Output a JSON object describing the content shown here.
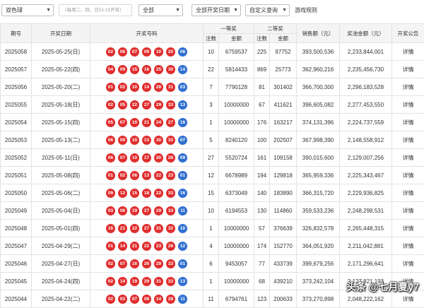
{
  "filters": {
    "game": "双色球",
    "schedule_hint": "（每周二、四、日21:15开奖）",
    "range": "全部",
    "date_type": "全部开奖日期",
    "custom_query": "自定义查询",
    "rules_link": "游戏规则"
  },
  "table": {
    "headers": {
      "issue": "期号",
      "date": "开奖日期",
      "numbers": "开奖号码",
      "first_prize": "一等奖",
      "second_prize": "二等奖",
      "count": "注数",
      "amount": "金额",
      "sales": "销售额（元）",
      "pool": "奖池金额（元）",
      "notice": "开奖公告"
    },
    "rows": [
      {
        "issue": "2025058",
        "date": "2025-05-25(日)",
        "reds": [
          "02",
          "06",
          "07",
          "09",
          "10",
          "20"
        ],
        "blue": "06",
        "first_count": "10",
        "first_amount": "6759537",
        "second_count": "225",
        "second_amount": "97752",
        "sales": "393,500,536",
        "pool": "2,233,844,001",
        "notice": "详情"
      },
      {
        "issue": "2025057",
        "date": "2025-05-22(四)",
        "reds": [
          "04",
          "09",
          "15",
          "16",
          "25",
          "30"
        ],
        "blue": "14",
        "first_count": "22",
        "first_amount": "5814433",
        "second_count": "869",
        "second_amount": "25773",
        "sales": "362,960,216",
        "pool": "2,235,456,730",
        "notice": "详情"
      },
      {
        "issue": "2025056",
        "date": "2025-05-20(二)",
        "reds": [
          "01",
          "02",
          "10",
          "14",
          "28",
          "31"
        ],
        "blue": "03",
        "first_count": "7",
        "first_amount": "7790128",
        "second_count": "81",
        "second_amount": "301402",
        "sales": "366,700,300",
        "pool": "2,296,183,528",
        "notice": "详情"
      },
      {
        "issue": "2025055",
        "date": "2025-05-18(日)",
        "reds": [
          "02",
          "05",
          "22",
          "27",
          "29",
          "33"
        ],
        "blue": "13",
        "first_count": "3",
        "first_amount": "10000000",
        "second_count": "67",
        "second_amount": "411621",
        "sales": "396,605,082",
        "pool": "2,277,453,550",
        "notice": "详情"
      },
      {
        "issue": "2025054",
        "date": "2025-05-15(四)",
        "reds": [
          "05",
          "07",
          "10",
          "21",
          "24",
          "27"
        ],
        "blue": "16",
        "first_count": "1",
        "first_amount": "10000000",
        "second_count": "176",
        "second_amount": "163217",
        "sales": "374,131,396",
        "pool": "2,224,737,559",
        "notice": "详情"
      },
      {
        "issue": "2025053",
        "date": "2025-05-13(二)",
        "reds": [
          "06",
          "09",
          "10",
          "13",
          "30",
          "33"
        ],
        "blue": "07",
        "first_count": "5",
        "first_amount": "8240120",
        "second_count": "100",
        "second_amount": "202507",
        "sales": "367,998,390",
        "pool": "2,148,558,912",
        "notice": "详情"
      },
      {
        "issue": "2025052",
        "date": "2025-05-11(日)",
        "reds": [
          "06",
          "07",
          "10",
          "17",
          "20",
          "26"
        ],
        "blue": "09",
        "first_count": "27",
        "first_amount": "5520724",
        "second_count": "161",
        "second_amount": "109158",
        "sales": "390,015,600",
        "pool": "2,129,007,256",
        "notice": "详情"
      },
      {
        "issue": "2025051",
        "date": "2025-05-08(四)",
        "reds": [
          "01",
          "02",
          "06",
          "13",
          "22",
          "23"
        ],
        "blue": "01",
        "first_count": "12",
        "first_amount": "6678989",
        "second_count": "194",
        "second_amount": "129818",
        "sales": "365,959,336",
        "pool": "2,225,343,467",
        "notice": "详情"
      },
      {
        "issue": "2025050",
        "date": "2025-05-06(二)",
        "reds": [
          "09",
          "12",
          "15",
          "18",
          "22",
          "33"
        ],
        "blue": "16",
        "first_count": "15",
        "first_amount": "6373049",
        "second_count": "140",
        "second_amount": "183890",
        "sales": "366,315,720",
        "pool": "2,229,936,825",
        "notice": "详情"
      },
      {
        "issue": "2025049",
        "date": "2025-05-04(日)",
        "reds": [
          "03",
          "06",
          "19",
          "27",
          "29",
          "33"
        ],
        "blue": "11",
        "first_count": "10",
        "first_amount": "6194553",
        "second_count": "130",
        "second_amount": "114860",
        "sales": "359,533,236",
        "pool": "2,248,298,531",
        "notice": "详情"
      },
      {
        "issue": "2025048",
        "date": "2025-05-01(四)",
        "reds": [
          "16",
          "21",
          "22",
          "27",
          "31",
          "32"
        ],
        "blue": "10",
        "first_count": "1",
        "first_amount": "10000000",
        "second_count": "57",
        "second_amount": "376639",
        "sales": "326,832,578",
        "pool": "2,265,448,315",
        "notice": "详情"
      },
      {
        "issue": "2025047",
        "date": "2025-04-29(二)",
        "reds": [
          "01",
          "14",
          "21",
          "22",
          "23",
          "26"
        ],
        "blue": "12",
        "first_count": "4",
        "first_amount": "10000000",
        "second_count": "174",
        "second_amount": "152770",
        "sales": "364,051,920",
        "pool": "2,211,042,881",
        "notice": "详情"
      },
      {
        "issue": "2025046",
        "date": "2025-04-27(日)",
        "reds": [
          "02",
          "07",
          "16",
          "26",
          "29",
          "33"
        ],
        "blue": "01",
        "first_count": "6",
        "first_amount": "9453057",
        "second_count": "77",
        "second_amount": "433739",
        "sales": "399,679,256",
        "pool": "2,171,296,641",
        "notice": "详情"
      },
      {
        "issue": "2025045",
        "date": "2025-04-24(四)",
        "reds": [
          "02",
          "14",
          "19",
          "29",
          "31",
          "33"
        ],
        "blue": "13",
        "first_count": "1",
        "first_amount": "10000000",
        "second_count": "68",
        "second_amount": "439210",
        "sales": "373,242,104",
        "pool": "2,127,821,193",
        "notice": "详情"
      },
      {
        "issue": "2025044",
        "date": "2025-04-22(二)",
        "reds": [
          "02",
          "03",
          "07",
          "08",
          "14",
          "28"
        ],
        "blue": "11",
        "first_count": "11",
        "first_amount": "6794761",
        "second_count": "123",
        "second_amount": "200633",
        "sales": "373,270,898",
        "pool": "2,048,222,162",
        "notice": "详情"
      }
    ]
  },
  "watermark": "头条 @七月夏y7",
  "colors": {
    "red_ball": "#e02d2d",
    "blue_ball": "#2f6fd1"
  }
}
